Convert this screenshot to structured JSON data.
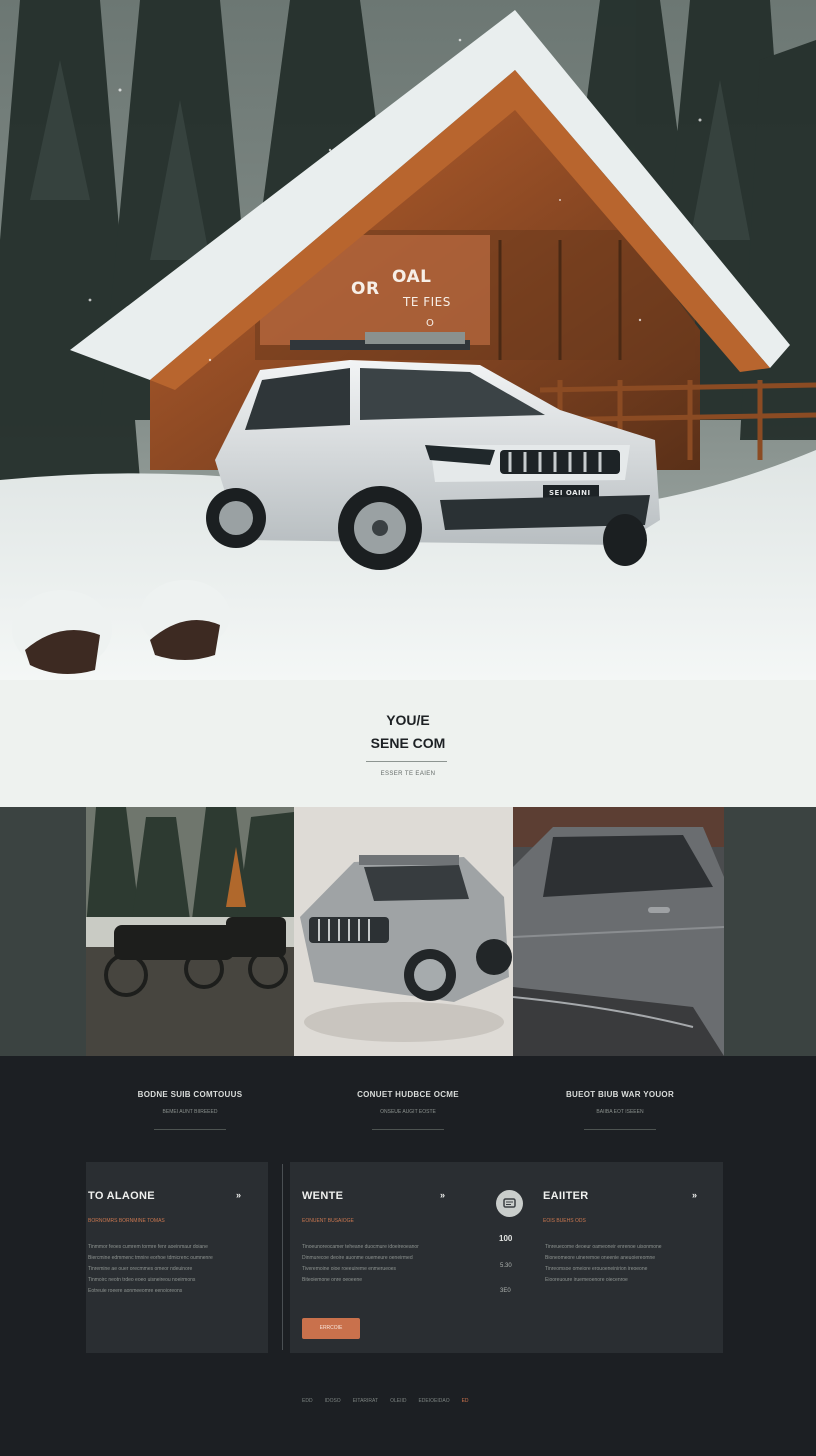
{
  "hero": {
    "line1_left": "OR",
    "line1_right": "OAL",
    "line2": "TE FIES",
    "line2_mark": "O",
    "plate": "SEI OAINI"
  },
  "intro": {
    "title_line1": "YOU/E",
    "title_line2": "SENE COM",
    "caption": "ESSER TE EAIEN"
  },
  "features": [
    {
      "title": "BODNE SUIB COMTOUUS",
      "subtitle": "BEMEI AUNT BIIREEED"
    },
    {
      "title": "CONUET HUDBCE OCME",
      "subtitle": "ONSEUE AUGIT EOSTE"
    },
    {
      "title": "BUEOT BIUB WAR YOUOR",
      "subtitle": "BAIIBA EOT ISEEEN"
    }
  ],
  "cards": [
    {
      "title": "TO ALAONE",
      "arrow": "»",
      "subtitle": "BORNOMRS BORNMINE TOMAS",
      "lines": [
        "Tinmmor feoes cumrem tormre fenr aoeinmaur doiane",
        "Biercmine edmmenc tmnire eorhoe tdmicrenc oumnenre",
        "Tinremine ae ouer orecmmes omeor ndeuinore",
        "Tinmoirc neotn trdeo eoeo uisneireou noeirmons",
        "Eotreuie roeere aonmeeomre eenoioreons"
      ]
    },
    {
      "title": "WENTE",
      "arrow": "»",
      "subtitle": "EONUENT BUSAIOGE",
      "lines": [
        "Tinoeunoreocamer teheane duocmure idoeireoeanor",
        "Dinmurecoe deoire auonme ouemeure oeneirmed",
        "Tiveremoine oioe roeeuireme enmerueoes",
        "Biteoiemone onre oeoeene"
      ],
      "cta": "ERRCOIE"
    },
    {
      "title": "EAIITER",
      "arrow": "»",
      "subtitle": "EOIS BUEHS ODS",
      "lines": [
        "Tinreuecome deoeur oameoneir enrenoe uisonmone",
        "Bioneomeore uineremoe oneenie aneuoiereomne",
        "Tinreomsoe omeiore erouoeneinirion ireoeone",
        "Eiooreuoure iruemeoenore oiecenroe"
      ]
    }
  ],
  "stats": [
    "100",
    "5.30",
    "3E0"
  ],
  "footer_links": [
    "EDD",
    "IDOSO",
    "EITARIRAT",
    "OLEIID",
    "EDEIOEIDAO",
    "ED"
  ],
  "colors": {
    "accent": "#c9714c",
    "dark_bg": "#1c1f23",
    "card_bg": "#2a2e32",
    "light_bg": "#eef2ef"
  }
}
